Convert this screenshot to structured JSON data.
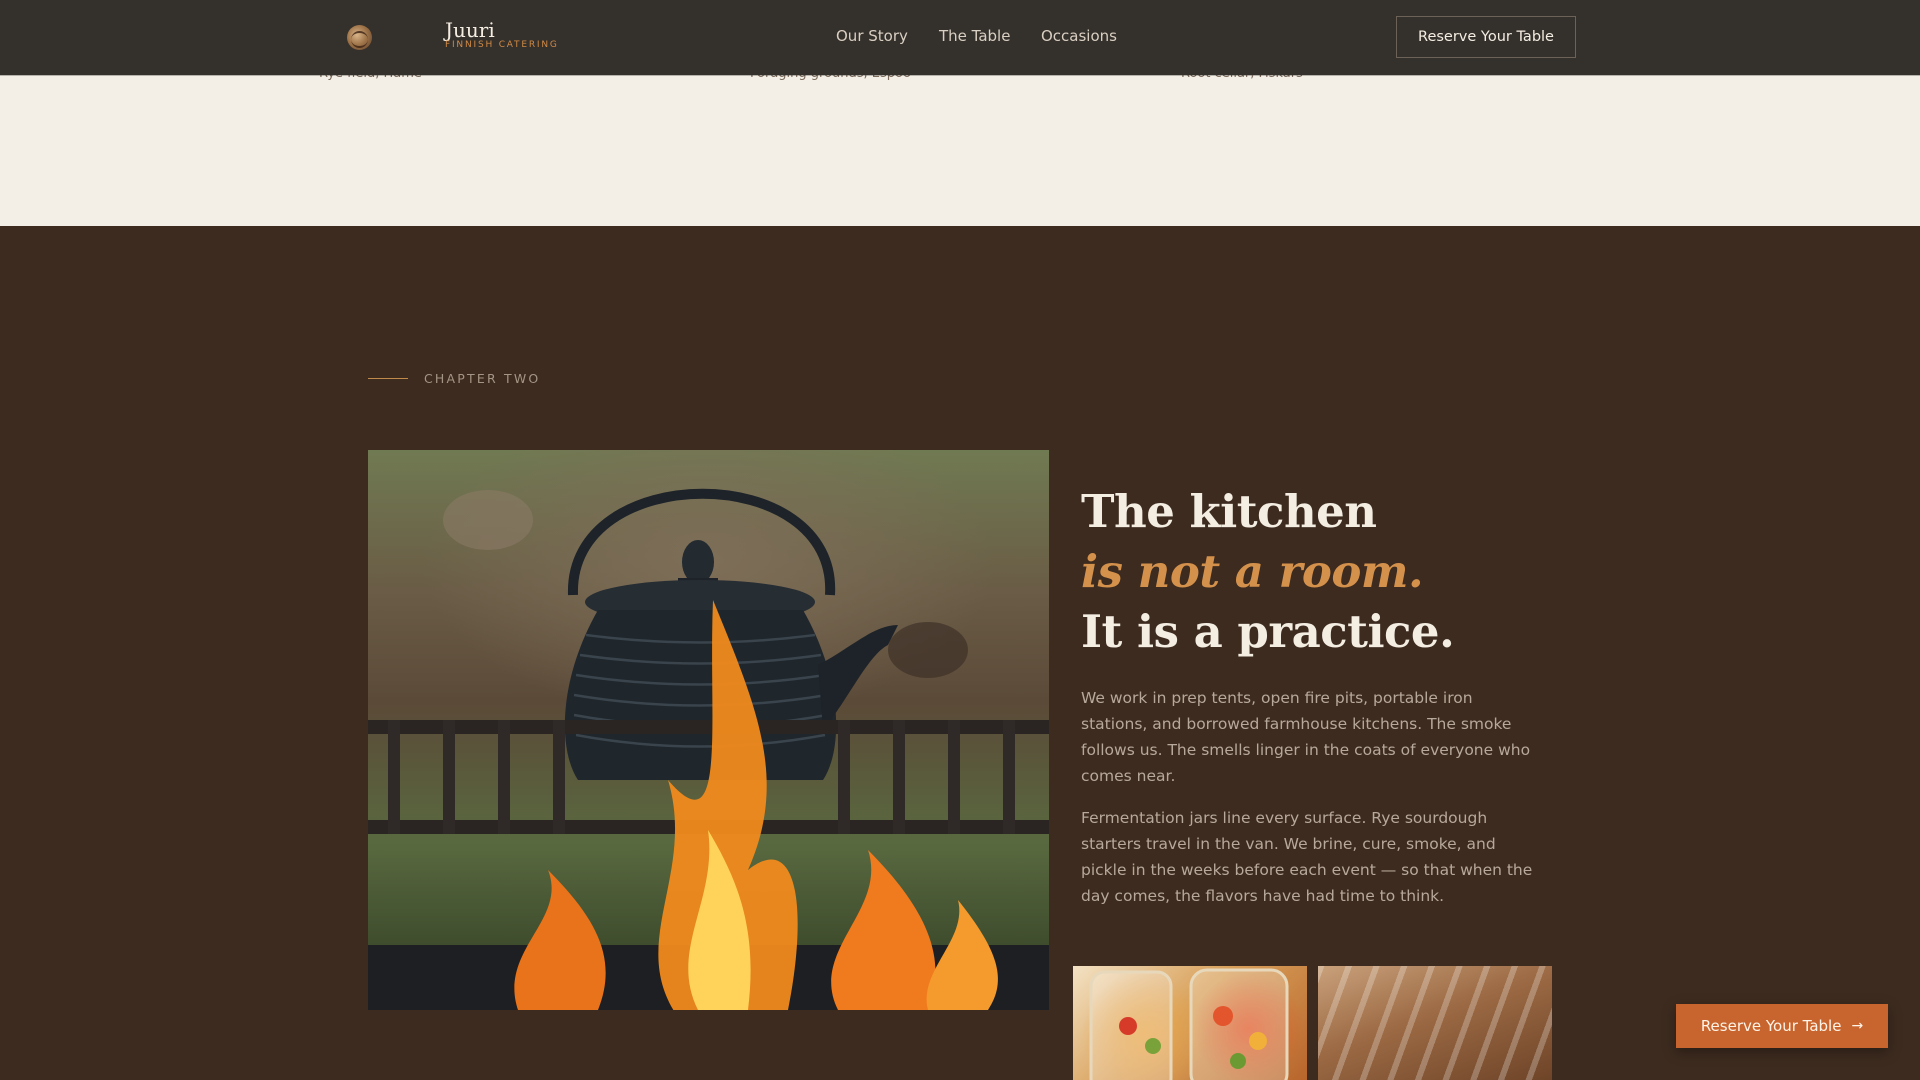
{
  "header": {
    "brand_name": "Juuri",
    "brand_tagline": "FINNISH CATERING",
    "nav": [
      "Our Story",
      "The Table",
      "Occasions"
    ],
    "cta_label": "Reserve Your Table"
  },
  "previous_section": {
    "captions": [
      "Rye field, Häme",
      "Foraging grounds, Espoo",
      "Root cellar, Fiskars"
    ]
  },
  "chapter": {
    "label": "CHAPTER TWO",
    "headline_line1": "The kitchen",
    "headline_accent": "is not a room.",
    "headline_line3": "It is a practice.",
    "body_1": "We work in prep tents, open fire pits, portable iron stations, and borrowed farmhouse kitchens. The smoke follows us. The smells linger in the coats of everyone who comes near.",
    "body_2": "Fermentation jars line every surface. Rye sourdough starters travel in the van. We brine, cure, smoke, and pickle in the weeks before each event — so that when the day comes, the flavors have had time to think."
  },
  "floating_cta": {
    "label": "Reserve Your Table",
    "icon": "arrow-right-icon"
  },
  "colors": {
    "accent": "#d4914c",
    "cta_orange": "#c8642e",
    "section_brown": "#3d2b1f",
    "cream": "#f3efe6"
  }
}
